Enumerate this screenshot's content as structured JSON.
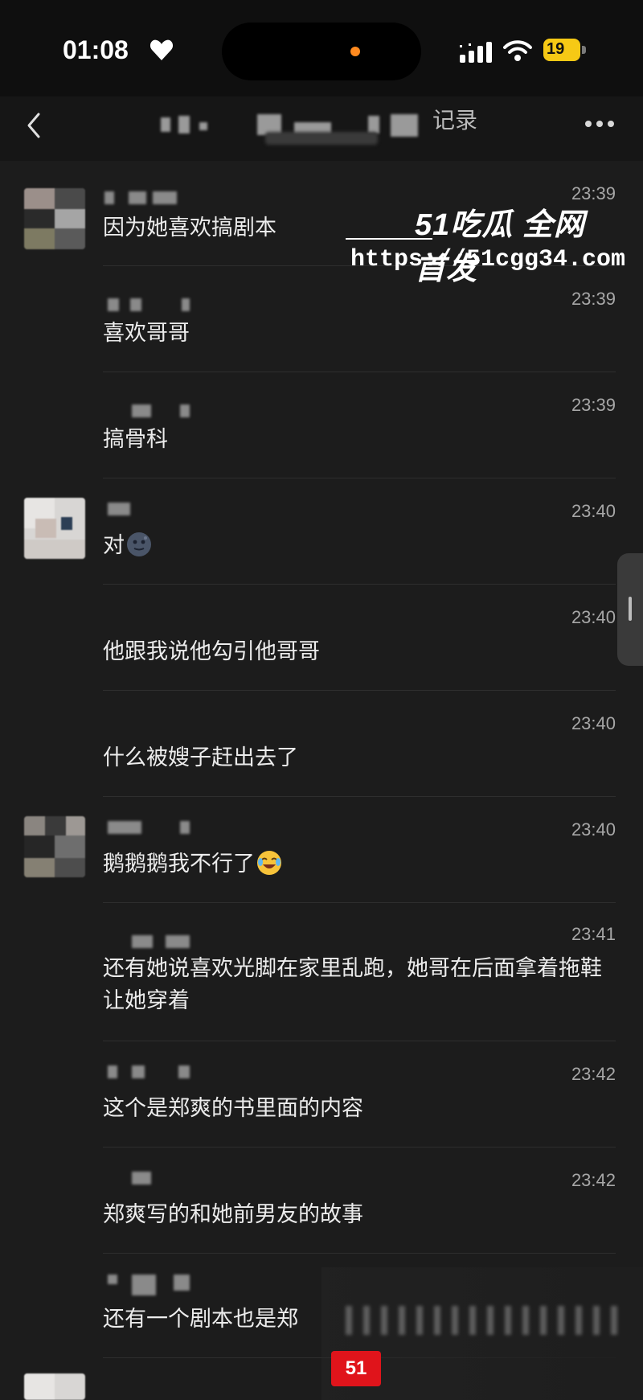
{
  "status_bar": {
    "time": "01:08",
    "battery": "19",
    "icons": [
      "heart-icon",
      "signal-icon",
      "wifi-icon",
      "battery-icon"
    ]
  },
  "nav": {
    "title_suffix": "记录",
    "icons": [
      "back-icon",
      "more-icon"
    ]
  },
  "watermark": {
    "brand": "51吃瓜 全网首发",
    "url": "https://51cgg34.com"
  },
  "messages": [
    {
      "time": "23:39",
      "text": "因为她喜欢搞剧本"
    },
    {
      "time": "23:39",
      "text": "喜欢哥哥"
    },
    {
      "time": "23:39",
      "text": "搞骨科"
    },
    {
      "time": "23:40",
      "text": "对",
      "emoji": "dark-moon-face-emoji"
    },
    {
      "time": "23:40",
      "text": "他跟我说他勾引他哥哥"
    },
    {
      "time": "23:40",
      "text": "什么被嫂子赶出去了"
    },
    {
      "time": "23:40",
      "text": "鹅鹅鹅我不行了",
      "emoji": "laughing-crying-emoji"
    },
    {
      "time": "23:41",
      "text": "还有她说喜欢光脚在家里乱跑，她哥在后面拿着拖鞋让她穿着"
    },
    {
      "time": "23:42",
      "text": "这个是郑爽的书里面的内容"
    },
    {
      "time": "23:42",
      "text": "郑爽写的和她前男友的故事"
    },
    {
      "text": "还有一个剧本也是郑"
    }
  ],
  "colors": {
    "background": "#1c1c1c",
    "text": "#ececec",
    "timestamp": "#a7a7a7",
    "battery": "#f6c915",
    "island_dot": "#ff8a1f"
  }
}
